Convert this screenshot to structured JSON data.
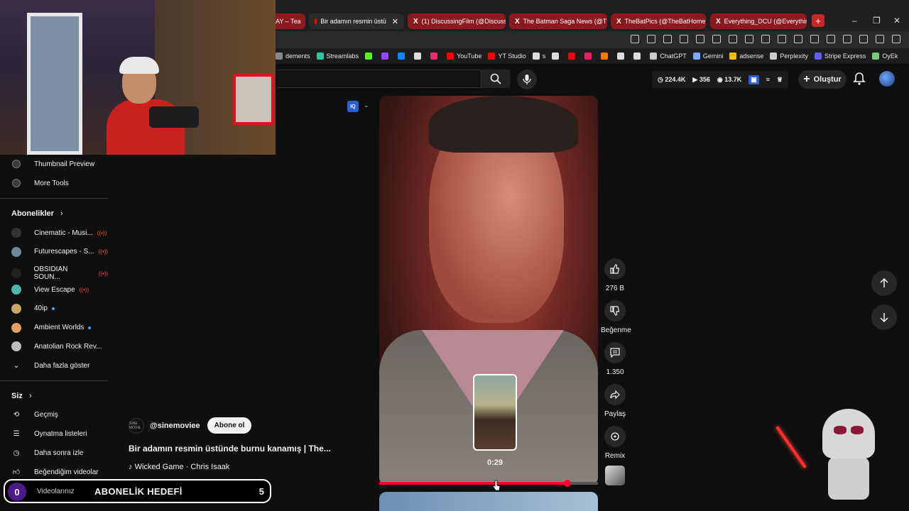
{
  "browser": {
    "tabs": [
      {
        "label": "AY – Tea",
        "kind": "plain",
        "active": false
      },
      {
        "label": "Bir adamın resmin üstü",
        "kind": "youtube",
        "active": true
      },
      {
        "label": "(1) DiscussingFilm (@Discussin",
        "kind": "x",
        "active": false
      },
      {
        "label": "The Batman Saga News (@The",
        "kind": "x",
        "active": false
      },
      {
        "label": "TheBatPics (@TheBatHome) / X",
        "kind": "x",
        "active": false
      },
      {
        "label": "Everything_DCU (@Everything",
        "kind": "x",
        "active": false
      }
    ],
    "new_tab": "+",
    "window_controls": [
      "–",
      "❐",
      "✕"
    ],
    "bookmarks": [
      {
        "label": "dements",
        "color": "#888888"
      },
      {
        "label": "Streamlabs",
        "color": "#31c3a2"
      },
      {
        "label": "",
        "color": "#53fc18"
      },
      {
        "label": "",
        "color": "#9146ff"
      },
      {
        "label": "",
        "color": "#1185fe"
      },
      {
        "label": "",
        "color": "#dddddd"
      },
      {
        "label": "",
        "color": "#e1306c"
      },
      {
        "label": "YouTube",
        "color": "#ff0000"
      },
      {
        "label": "YT Studio",
        "color": "#ff0000"
      },
      {
        "label": "s",
        "color": "#dddddd"
      },
      {
        "label": "",
        "color": "#dddddd"
      },
      {
        "label": "",
        "color": "#e50914"
      },
      {
        "label": "",
        "color": "#e91e63"
      },
      {
        "label": "",
        "color": "#f57c00"
      },
      {
        "label": "",
        "color": "#dddddd"
      },
      {
        "label": "",
        "color": "#dddddd"
      },
      {
        "label": "ChatGPT",
        "color": "#cccccc"
      },
      {
        "label": "Gemini",
        "color": "#7aa7ff"
      },
      {
        "label": "adsense",
        "color": "#fbbc04"
      },
      {
        "label": "Perplexity",
        "color": "#cccccc"
      },
      {
        "label": "Stripe Express",
        "color": "#635bff"
      },
      {
        "label": "OyEk",
        "color": "#7bc67b"
      }
    ]
  },
  "header": {
    "stats": {
      "views": "224.4K",
      "videos": "356",
      "subs": "13.7K"
    },
    "create_label": "Oluştur"
  },
  "sidebar": {
    "tools": [
      {
        "label": "Thumbnail Preview"
      },
      {
        "label": "More Tools"
      }
    ],
    "subs_heading": "Abonelikler",
    "subscriptions": [
      {
        "label": "Cinematic - Musi...",
        "badge": "live",
        "color": "#333333"
      },
      {
        "label": "Futurescapes - S...",
        "badge": "live",
        "color": "#6c8a9b"
      },
      {
        "label": "OBSIDIAN SOUN...",
        "badge": "live",
        "color": "#222222"
      },
      {
        "label": "View Escape",
        "badge": "live",
        "color": "#4db6ac"
      },
      {
        "label": "40ip",
        "badge": "dot",
        "color": "#c9a86a"
      },
      {
        "label": "Ambient Worlds",
        "badge": "dot",
        "color": "#e0a060"
      },
      {
        "label": "Anatolian Rock Rev...",
        "badge": "",
        "color": "#bbbbbb"
      }
    ],
    "show_more": "Daha fazla göster",
    "you_heading": "Siz",
    "you_items": [
      {
        "label": "Geçmiş"
      },
      {
        "label": "Oynatma listeleri"
      },
      {
        "label": "Daha sonra izle"
      },
      {
        "label": "Beğendiğim videolar"
      },
      {
        "label": "Videolarınız"
      }
    ]
  },
  "sub_goal": {
    "current": "0",
    "label": "ABONELİK HEDEFİ",
    "goal": "5"
  },
  "short": {
    "channel": "@sinemoviee",
    "channel_avatar_text": "SINE MOVIE",
    "subscribe_label": "Abone ol",
    "title": "Bir adamın resmin üstünde burnu kanamış | The...",
    "music": "Wicked Game · Chris Isaak",
    "seek_time": "0:29",
    "progress_fraction": 0.86,
    "preview_fraction": 0.53
  },
  "actions": {
    "like_count": "276 B",
    "dislike_label": "Beğenme",
    "comment_count": "1.350",
    "share_label": "Paylaş",
    "remix_label": "Remix"
  },
  "iq_label": "IQ"
}
